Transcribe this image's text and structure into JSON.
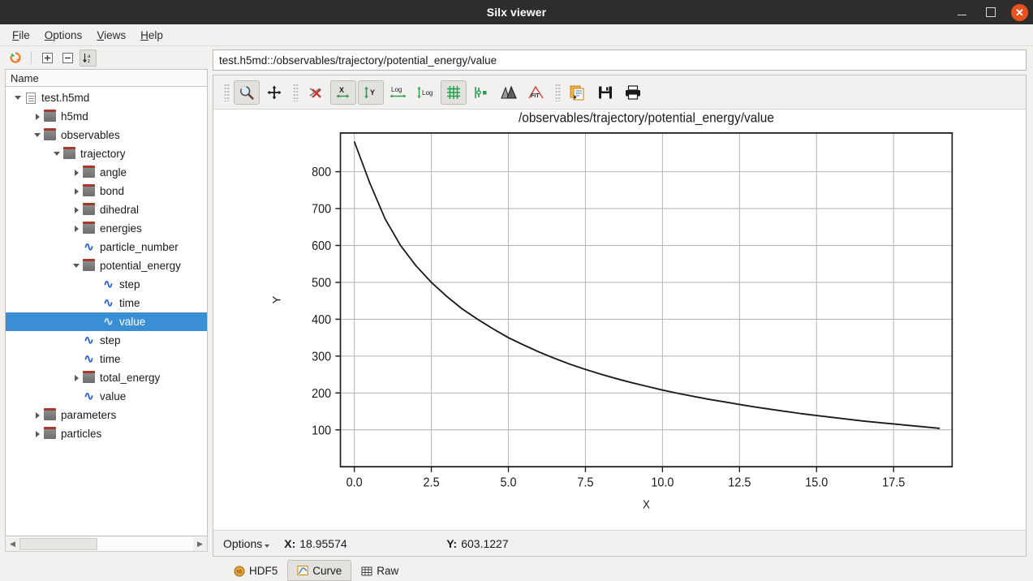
{
  "window": {
    "title": "Silx viewer",
    "controls": [
      {
        "name": "minimize",
        "glyph": "–"
      },
      {
        "name": "maximize",
        "glyph": "☐"
      },
      {
        "name": "close",
        "glyph": "✕"
      }
    ]
  },
  "menubar": {
    "items": [
      {
        "label": "File",
        "mnemonic": "F"
      },
      {
        "label": "Options",
        "mnemonic": "O"
      },
      {
        "label": "Views",
        "mnemonic": "V"
      },
      {
        "label": "Help",
        "mnemonic": "H"
      }
    ]
  },
  "tree_toolbar": {
    "buttons": [
      {
        "name": "refresh-icon",
        "title": "Refresh"
      },
      {
        "name": "expand-all-icon",
        "title": "Expand all"
      },
      {
        "name": "collapse-all-icon",
        "title": "Collapse all"
      },
      {
        "name": "sort-az-icon",
        "title": "Sort alphabetically",
        "pressed": true
      }
    ]
  },
  "tree": {
    "header": "Name",
    "items": [
      {
        "label": "test.h5md",
        "depth": 0,
        "icon": "file-icon",
        "expander": "down",
        "selected": false
      },
      {
        "label": "h5md",
        "depth": 1,
        "icon": "group-icon",
        "expander": "right",
        "selected": false
      },
      {
        "label": "observables",
        "depth": 1,
        "icon": "group-icon",
        "expander": "down",
        "selected": false
      },
      {
        "label": "trajectory",
        "depth": 2,
        "icon": "group-icon",
        "expander": "down",
        "selected": false
      },
      {
        "label": "angle",
        "depth": 3,
        "icon": "group-icon",
        "expander": "right",
        "selected": false
      },
      {
        "label": "bond",
        "depth": 3,
        "icon": "group-icon",
        "expander": "right",
        "selected": false
      },
      {
        "label": "dihedral",
        "depth": 3,
        "icon": "group-icon",
        "expander": "right",
        "selected": false
      },
      {
        "label": "energies",
        "depth": 3,
        "icon": "group-icon",
        "expander": "right",
        "selected": false
      },
      {
        "label": "particle_number",
        "depth": 3,
        "icon": "dataset-icon",
        "expander": "none",
        "selected": false
      },
      {
        "label": "potential_energy",
        "depth": 3,
        "icon": "group-icon",
        "expander": "down",
        "selected": false
      },
      {
        "label": "step",
        "depth": 4,
        "icon": "dataset-icon",
        "expander": "none",
        "selected": false
      },
      {
        "label": "time",
        "depth": 4,
        "icon": "dataset-icon",
        "expander": "none",
        "selected": false
      },
      {
        "label": "value",
        "depth": 4,
        "icon": "dataset-icon",
        "expander": "none",
        "selected": true
      },
      {
        "label": "step",
        "depth": 3,
        "icon": "dataset-icon",
        "expander": "none",
        "selected": false
      },
      {
        "label": "time",
        "depth": 3,
        "icon": "dataset-icon",
        "expander": "none",
        "selected": false
      },
      {
        "label": "total_energy",
        "depth": 3,
        "icon": "group-icon",
        "expander": "right",
        "selected": false
      },
      {
        "label": "value",
        "depth": 3,
        "icon": "dataset-icon",
        "expander": "none",
        "selected": false
      },
      {
        "label": "parameters",
        "depth": 1,
        "icon": "group-icon",
        "expander": "right",
        "selected": false
      },
      {
        "label": "particles",
        "depth": 1,
        "icon": "group-icon",
        "expander": "right",
        "selected": false
      }
    ]
  },
  "pathbar": {
    "value": "test.h5md::/observables/trajectory/potential_energy/value"
  },
  "plot_toolbar": {
    "buttons": [
      {
        "name": "zoom-mode-icon",
        "label": "Zoom",
        "active": true
      },
      {
        "name": "pan-mode-icon",
        "label": "Pan",
        "active": false
      },
      {
        "name": "unselect-curve-icon",
        "label": "Unselect",
        "active": false
      },
      {
        "name": "x-autoscale-icon",
        "label": "X auto-scale",
        "active": true
      },
      {
        "name": "y-autoscale-icon",
        "label": "Y auto-scale",
        "active": true
      },
      {
        "name": "x-log-icon",
        "label": "X log",
        "active": false
      },
      {
        "name": "y-log-icon",
        "label": "Y log",
        "active": false
      },
      {
        "name": "grid-icon",
        "label": "Grid",
        "active": true
      },
      {
        "name": "curve-style-icon",
        "label": "Curve style",
        "active": false
      },
      {
        "name": "roi-icon",
        "label": "ROI",
        "active": false
      },
      {
        "name": "fit-icon",
        "label": "Fit",
        "active": false
      },
      {
        "name": "copy-icon",
        "label": "Copy",
        "active": false
      },
      {
        "name": "save-icon",
        "label": "Save",
        "active": false
      },
      {
        "name": "print-icon",
        "label": "Print",
        "active": false
      }
    ]
  },
  "statusbar": {
    "options_label": "Options",
    "x_label": "X:",
    "x_value": "18.95574",
    "y_label": "Y:",
    "y_value": "603.1227"
  },
  "tabs": [
    {
      "label": "HDF5",
      "icon": "hdf5-icon",
      "active": false
    },
    {
      "label": "Curve",
      "icon": "curve-icon",
      "active": true
    },
    {
      "label": "Raw",
      "icon": "table-icon",
      "active": false
    }
  ],
  "colors": {
    "selection": "#3a8fd4",
    "accent": "#e8521f",
    "curve": "#1a1a1a",
    "grid": "#b8b8b8"
  },
  "chart_data": {
    "type": "line",
    "title": "/observables/trajectory/potential_energy/value",
    "xlabel": "X",
    "ylabel": "Y",
    "xlim": [
      -0.45,
      19.4
    ],
    "ylim": [
      0,
      905
    ],
    "grid": true,
    "legend": null,
    "xticks": [
      "0.0",
      "2.5",
      "5.0",
      "7.5",
      "10.0",
      "12.5",
      "15.0",
      "17.5"
    ],
    "xtick_values": [
      0.0,
      2.5,
      5.0,
      7.5,
      10.0,
      12.5,
      15.0,
      17.5
    ],
    "yticks": [
      "100",
      "200",
      "300",
      "400",
      "500",
      "600",
      "700",
      "800"
    ],
    "ytick_values": [
      100,
      200,
      300,
      400,
      500,
      600,
      700,
      800
    ],
    "series": [
      {
        "name": "value",
        "color": "#1a1a1a",
        "x": [
          0,
          0.5,
          1,
          1.5,
          2,
          2.5,
          3,
          3.5,
          4,
          4.5,
          5,
          5.5,
          6,
          6.5,
          7,
          7.5,
          8,
          8.5,
          9,
          9.5,
          10,
          10.5,
          11,
          11.5,
          12,
          12.5,
          13,
          13.5,
          14,
          14.5,
          15,
          15.5,
          16,
          16.5,
          17,
          17.5,
          18,
          18.5,
          19
        ],
        "y": [
          882,
          770,
          672,
          600,
          545,
          500,
          462,
          428,
          400,
          374,
          350,
          330,
          311,
          294,
          278,
          264,
          251,
          239,
          228,
          218,
          208,
          199,
          191,
          183,
          176,
          169,
          162,
          156,
          150,
          144,
          139,
          134,
          129,
          124,
          120,
          116,
          112,
          108,
          104
        ]
      }
    ]
  }
}
